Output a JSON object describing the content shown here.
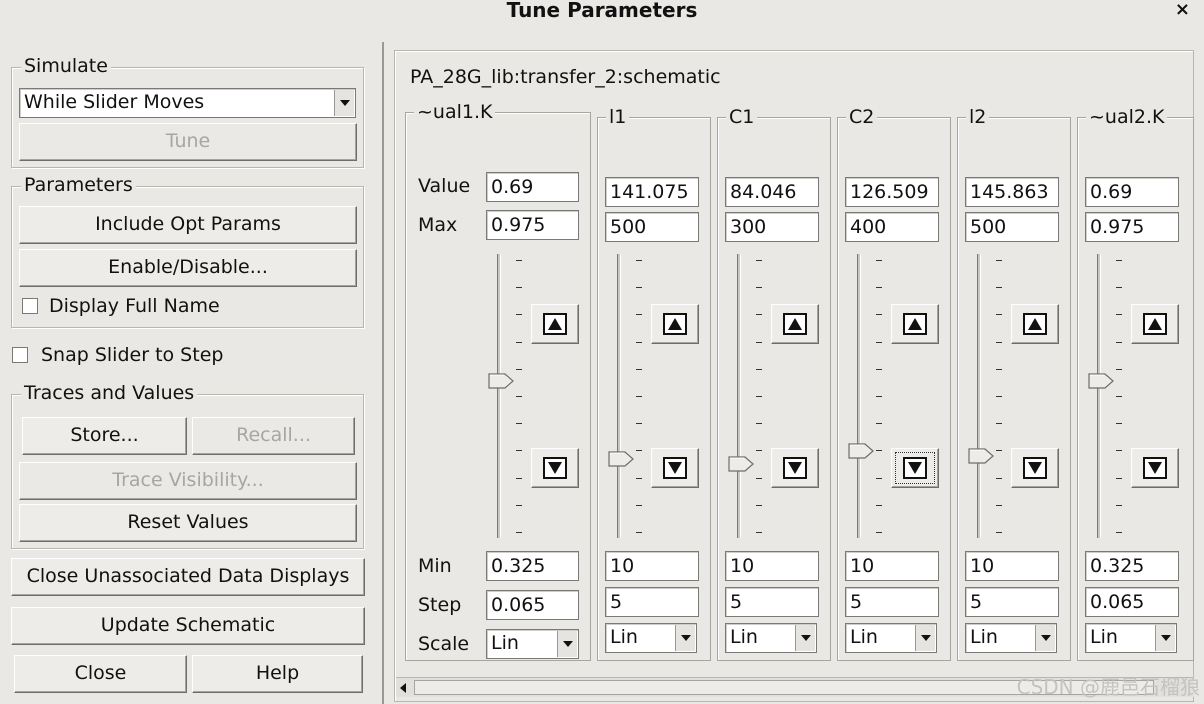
{
  "window": {
    "title": "Tune Parameters",
    "close_glyph": "×"
  },
  "simulate": {
    "group_label": "Simulate",
    "mode_value": "While Slider Moves",
    "tune_label": "Tune"
  },
  "parameters": {
    "group_label": "Parameters",
    "include_opt_label": "Include Opt Params",
    "enable_disable_label": "Enable/Disable...",
    "display_full_name_label": "Display Full Name"
  },
  "snap_slider_label": "Snap Slider to Step",
  "traces": {
    "group_label": "Traces and Values",
    "store_label": "Store...",
    "recall_label": "Recall...",
    "trace_visibility_label": "Trace Visibility...",
    "reset_values_label": "Reset Values"
  },
  "close_unassociated_label": "Close Unassociated Data Displays",
  "update_schematic_label": "Update Schematic",
  "close_label": "Close",
  "help_label": "Help",
  "schematic_path": "PA_28G_lib:transfer_2:schematic",
  "row_labels": {
    "value": "Value",
    "max": "Max",
    "min": "Min",
    "step": "Step",
    "scale": "Scale"
  },
  "columns": [
    {
      "name": "~ual1.K",
      "value": "0.69",
      "max": "0.975",
      "min": "0.325",
      "step": "0.065",
      "scale": "Lin",
      "slider_fraction": 0.56
    },
    {
      "name": "l1",
      "value": "141.075",
      "max": "500",
      "min": "10",
      "step": "5",
      "scale": "Lin",
      "slider_fraction": 0.27
    },
    {
      "name": "C1",
      "value": "84.046",
      "max": "300",
      "min": "10",
      "step": "5",
      "scale": "Lin",
      "slider_fraction": 0.25
    },
    {
      "name": "C2",
      "value": "126.509",
      "max": "400",
      "min": "10",
      "step": "5",
      "scale": "Lin",
      "slider_fraction": 0.3
    },
    {
      "name": "l2",
      "value": "145.863",
      "max": "500",
      "min": "10",
      "step": "5",
      "scale": "Lin",
      "slider_fraction": 0.28
    },
    {
      "name": "~ual2.K",
      "value": "0.69",
      "max": "0.975",
      "min": "0.325",
      "step": "0.065",
      "scale": "Lin",
      "slider_fraction": 0.56
    }
  ],
  "watermark": "CSDN @鹿邑石榴狼"
}
